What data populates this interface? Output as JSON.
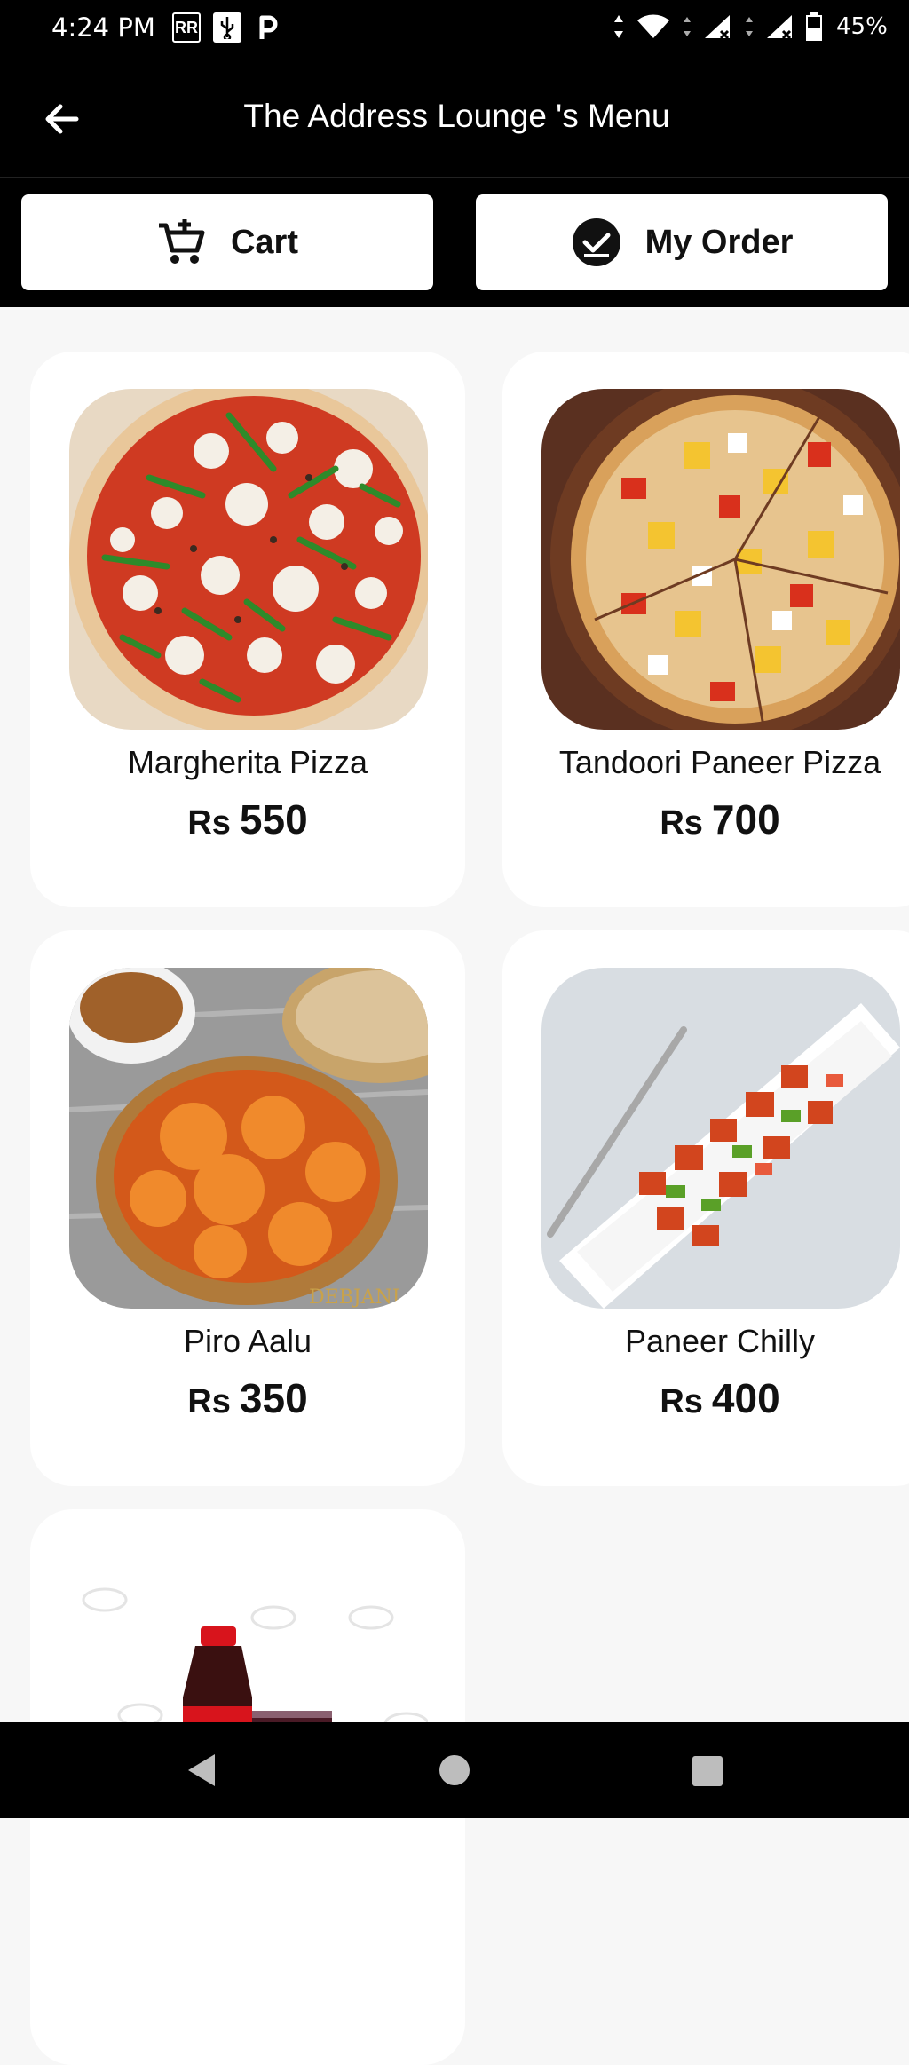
{
  "status_bar": {
    "time": "4:24 PM",
    "icons_left": [
      "rr-icon",
      "usb-icon",
      "p-icon"
    ],
    "battery": "45%"
  },
  "header": {
    "title": "The Address Lounge 's Menu"
  },
  "toolbar": {
    "cart_label": "Cart",
    "order_label": "My Order"
  },
  "menu": {
    "currency": "Rs",
    "items": [
      {
        "name": "Margherita Pizza",
        "price": "550"
      },
      {
        "name": "Tandoori Paneer Pizza",
        "price": "700"
      },
      {
        "name": "Piro Aalu",
        "price": "350"
      },
      {
        "name": "Paneer Chilly",
        "price": "400"
      },
      {
        "name": "",
        "price": ""
      }
    ]
  },
  "colors": {
    "header_bg": "#000000",
    "page_bg": "#f7f7f7",
    "card_bg": "#ffffff"
  }
}
